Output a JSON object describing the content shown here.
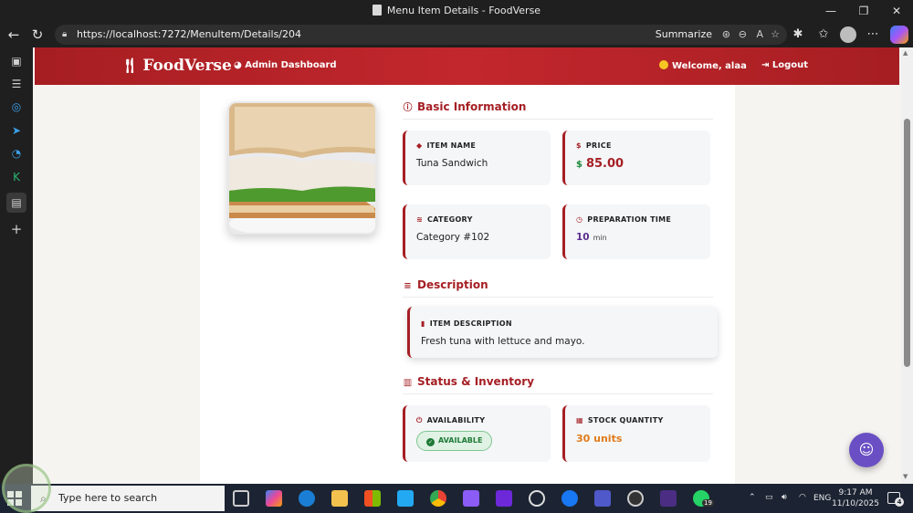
{
  "window": {
    "title": "Menu Item Details - FoodVerse",
    "controls": [
      "—",
      "❐",
      "✕"
    ]
  },
  "address_bar": {
    "url": "https://localhost:7272/MenuItem/Details/204",
    "summarize_label": "Summarize"
  },
  "site": {
    "brand": "FoodVerse",
    "nav_admin": "Admin Dashboard",
    "nav_welcome": "Welcome, alaa",
    "nav_logout": "Logout"
  },
  "basic_info": {
    "section_title": "Basic Information",
    "item_name_label": "ITEM NAME",
    "item_name": "Tuna Sandwich",
    "price_label": "PRICE",
    "price_currency": "$",
    "price_value": "85.00",
    "category_label": "CATEGORY",
    "category_value": "Category #102",
    "prep_label": "PREPARATION TIME",
    "prep_value": "10",
    "prep_unit": "min"
  },
  "description": {
    "section_title": "Description",
    "label": "ITEM DESCRIPTION",
    "text": "Fresh tuna with lettuce and mayo."
  },
  "status": {
    "section_title": "Status & Inventory",
    "availability_label": "AVAILABILITY",
    "availability_badge": "AVAILABLE",
    "stock_label": "STOCK QUANTITY",
    "stock_value": "30 units"
  },
  "taskbar": {
    "search_placeholder": "Type here to search",
    "language": "ENG",
    "time": "9:17 AM",
    "date": "11/10/2025",
    "whatsapp_badge": "19",
    "notification_count": "4"
  },
  "colors": {
    "brand_red": "#a51f24",
    "price_green": "#1e8a3c",
    "prep_purple": "#5b2d91",
    "stock_orange": "#e07b1a",
    "available_green": "#1e7a36",
    "chatbot_purple": "#6a4fc4"
  }
}
